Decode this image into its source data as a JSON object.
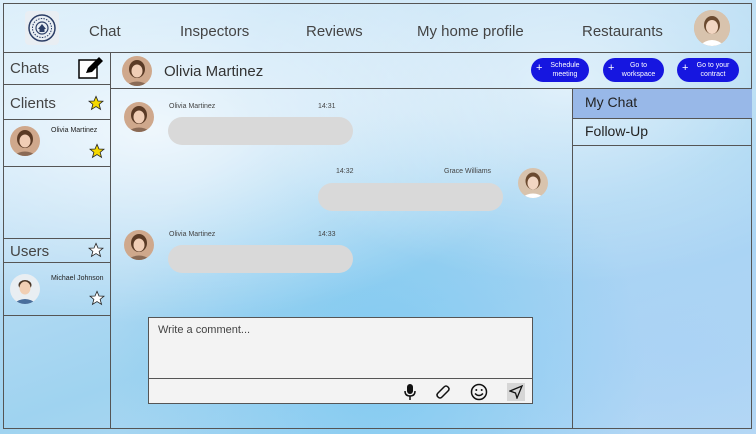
{
  "nav": {
    "items": [
      "Chat",
      "Inspectors",
      "Reviews",
      "My home profile",
      "Restaurants"
    ]
  },
  "sidebar": {
    "chats_title": "Chats",
    "clients_title": "Clients",
    "clients": [
      {
        "name": "Olivia Martinez"
      }
    ],
    "users_title": "Users",
    "users": [
      {
        "name": "Michael Johnson"
      }
    ]
  },
  "chat_header": {
    "contact_name": "Olivia Martinez",
    "actions": [
      {
        "label_line1": "Schedule",
        "label_line2": "meeting"
      },
      {
        "label_line1": "Go to",
        "label_line2": "workspace"
      },
      {
        "label_line1": "Go to your",
        "label_line2": "contract"
      }
    ]
  },
  "right_panel": {
    "tabs": [
      {
        "label": "My Chat",
        "active": true
      },
      {
        "label": "Follow-Up",
        "active": false
      }
    ]
  },
  "messages": [
    {
      "sender": "Olivia Martinez",
      "time": "14:31",
      "side": "left"
    },
    {
      "sender": "Grace Williams",
      "time": "14:32",
      "side": "right"
    },
    {
      "sender": "Olivia Martinez",
      "time": "14:33",
      "side": "left"
    }
  ],
  "composer": {
    "placeholder": "Write a comment...",
    "tools": [
      "microphone-icon",
      "paperclip-icon",
      "emoji-icon",
      "send-icon"
    ]
  },
  "colors": {
    "accent": "#1616e0",
    "active_tab": "#98b8e8",
    "bubble": "#d9d9d9",
    "star_fill": "#f5d800"
  }
}
